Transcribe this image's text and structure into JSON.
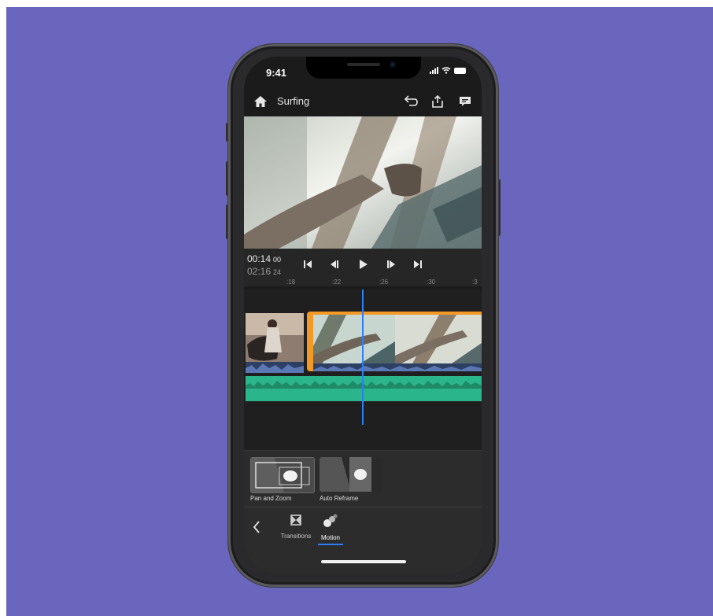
{
  "status_bar": {
    "time": "9:41"
  },
  "app_bar": {
    "title": "Surfing"
  },
  "icons": {
    "home": "home-icon",
    "undo": "undo-icon",
    "share": "share-icon",
    "feedback": "feedback-icon",
    "skip_start": "skip-start-icon",
    "step_back": "step-back-icon",
    "play": "play-icon",
    "step_forward": "step-forward-icon",
    "skip_end": "skip-end-icon",
    "back": "chevron-left-icon",
    "transitions": "transitions-icon",
    "motion": "motion-icon"
  },
  "transport": {
    "current_time": "00:14",
    "current_frames": "00",
    "total_time": "02:16",
    "total_frames": "24"
  },
  "ruler": {
    "ticks": [
      ":18",
      ":22",
      ":26",
      ":30",
      ":3"
    ]
  },
  "motion_presets": [
    {
      "label": "Pan and Zoom"
    },
    {
      "label": "Auto Reframe"
    }
  ],
  "bottom_nav": {
    "tabs": [
      {
        "label": "Transitions",
        "active": false
      },
      {
        "label": "Motion",
        "active": true
      }
    ]
  },
  "colors": {
    "background": "#6a66bd",
    "clip_selection": "#f29a25",
    "audio_waveform": "#2bb58a",
    "playhead": "#2d7ff9"
  }
}
